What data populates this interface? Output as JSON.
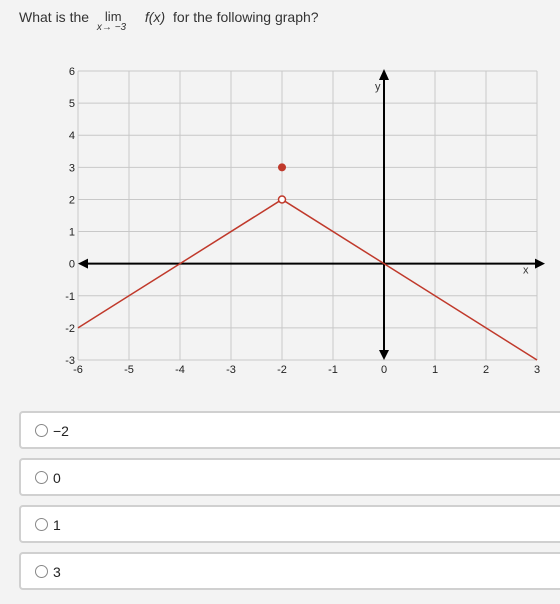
{
  "question": {
    "prefix": "What is the",
    "lim_word": "lim",
    "lim_sub": "x→ −3",
    "function": "f(x)",
    "suffix": "for the following graph?"
  },
  "graph": {
    "axis_x_label": "x",
    "axis_y_label": "y",
    "x_range": [
      -6,
      3
    ],
    "y_range": [
      -3,
      6
    ],
    "x_ticks": [
      "-6",
      "-5",
      "-4",
      "-3",
      "-2",
      "-1",
      "0",
      "1",
      "2",
      "3"
    ],
    "y_ticks": [
      "-3",
      "-2",
      "-1",
      "0",
      "1",
      "2",
      "3",
      "4",
      "5",
      "6"
    ],
    "line_color": "#c0392b",
    "segments": [
      {
        "from": [
          -6,
          -2
        ],
        "to": [
          -2,
          2
        ]
      },
      {
        "from": [
          -2,
          2
        ],
        "to": [
          3,
          -3
        ]
      }
    ],
    "open_points": [
      [
        -2,
        2
      ]
    ],
    "filled_points": [
      [
        -2,
        3
      ]
    ]
  },
  "options": [
    {
      "label": "−2"
    },
    {
      "label": "0"
    },
    {
      "label": "1"
    },
    {
      "label": "3"
    }
  ]
}
